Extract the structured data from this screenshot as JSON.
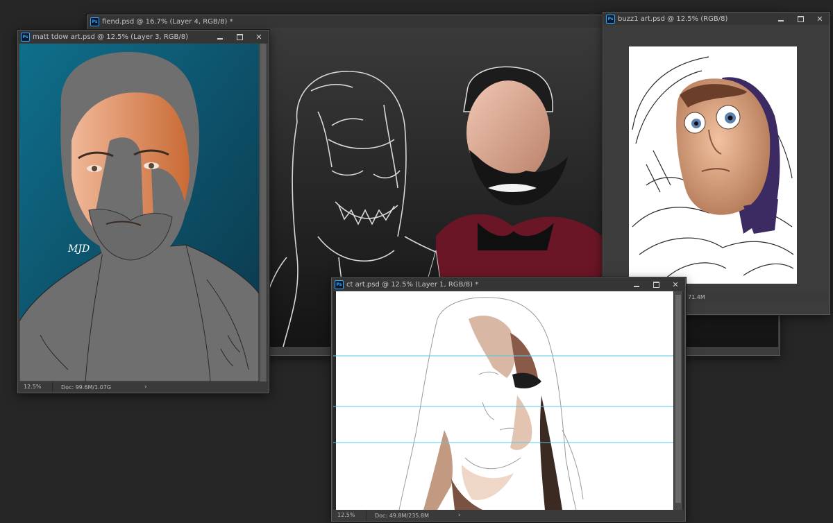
{
  "windows": {
    "fiend": {
      "title": "fiend.psd @ 16.7% (Layer 4, RGB/8) *"
    },
    "buzz": {
      "title": "buzz1 art.psd @ 12.5% (RGB/8)",
      "doc_partial": "71.4M"
    },
    "matt": {
      "title": "matt tdow art.psd @ 12.5% (Layer 3, RGB/8)",
      "zoom": "12.5%",
      "doc": "Doc: 99.6M/1.07G",
      "signature": "MJD"
    },
    "ct": {
      "title": "ct art.psd @ 12.5% (Layer 1, RGB/8) *",
      "zoom": "12.5%",
      "doc": "Doc: 49.8M/235.8M"
    }
  },
  "icons": {
    "app": "photoshop-ps-icon",
    "minimize": "minimize-icon",
    "maximize": "maximize-icon",
    "close": "close-icon",
    "status_arrow": "chevron-right-icon"
  },
  "strings": {
    "ps_glyph": "Ps",
    "close_glyph": "✕",
    "arrow_glyph": "›"
  },
  "colors": {
    "workspace": "#262626",
    "guide": "#56c8e6",
    "matt_bg": "#125a74",
    "skin": "#e7a07c",
    "flat_gray": "#6f6f6f",
    "maroon": "#6b1626"
  }
}
